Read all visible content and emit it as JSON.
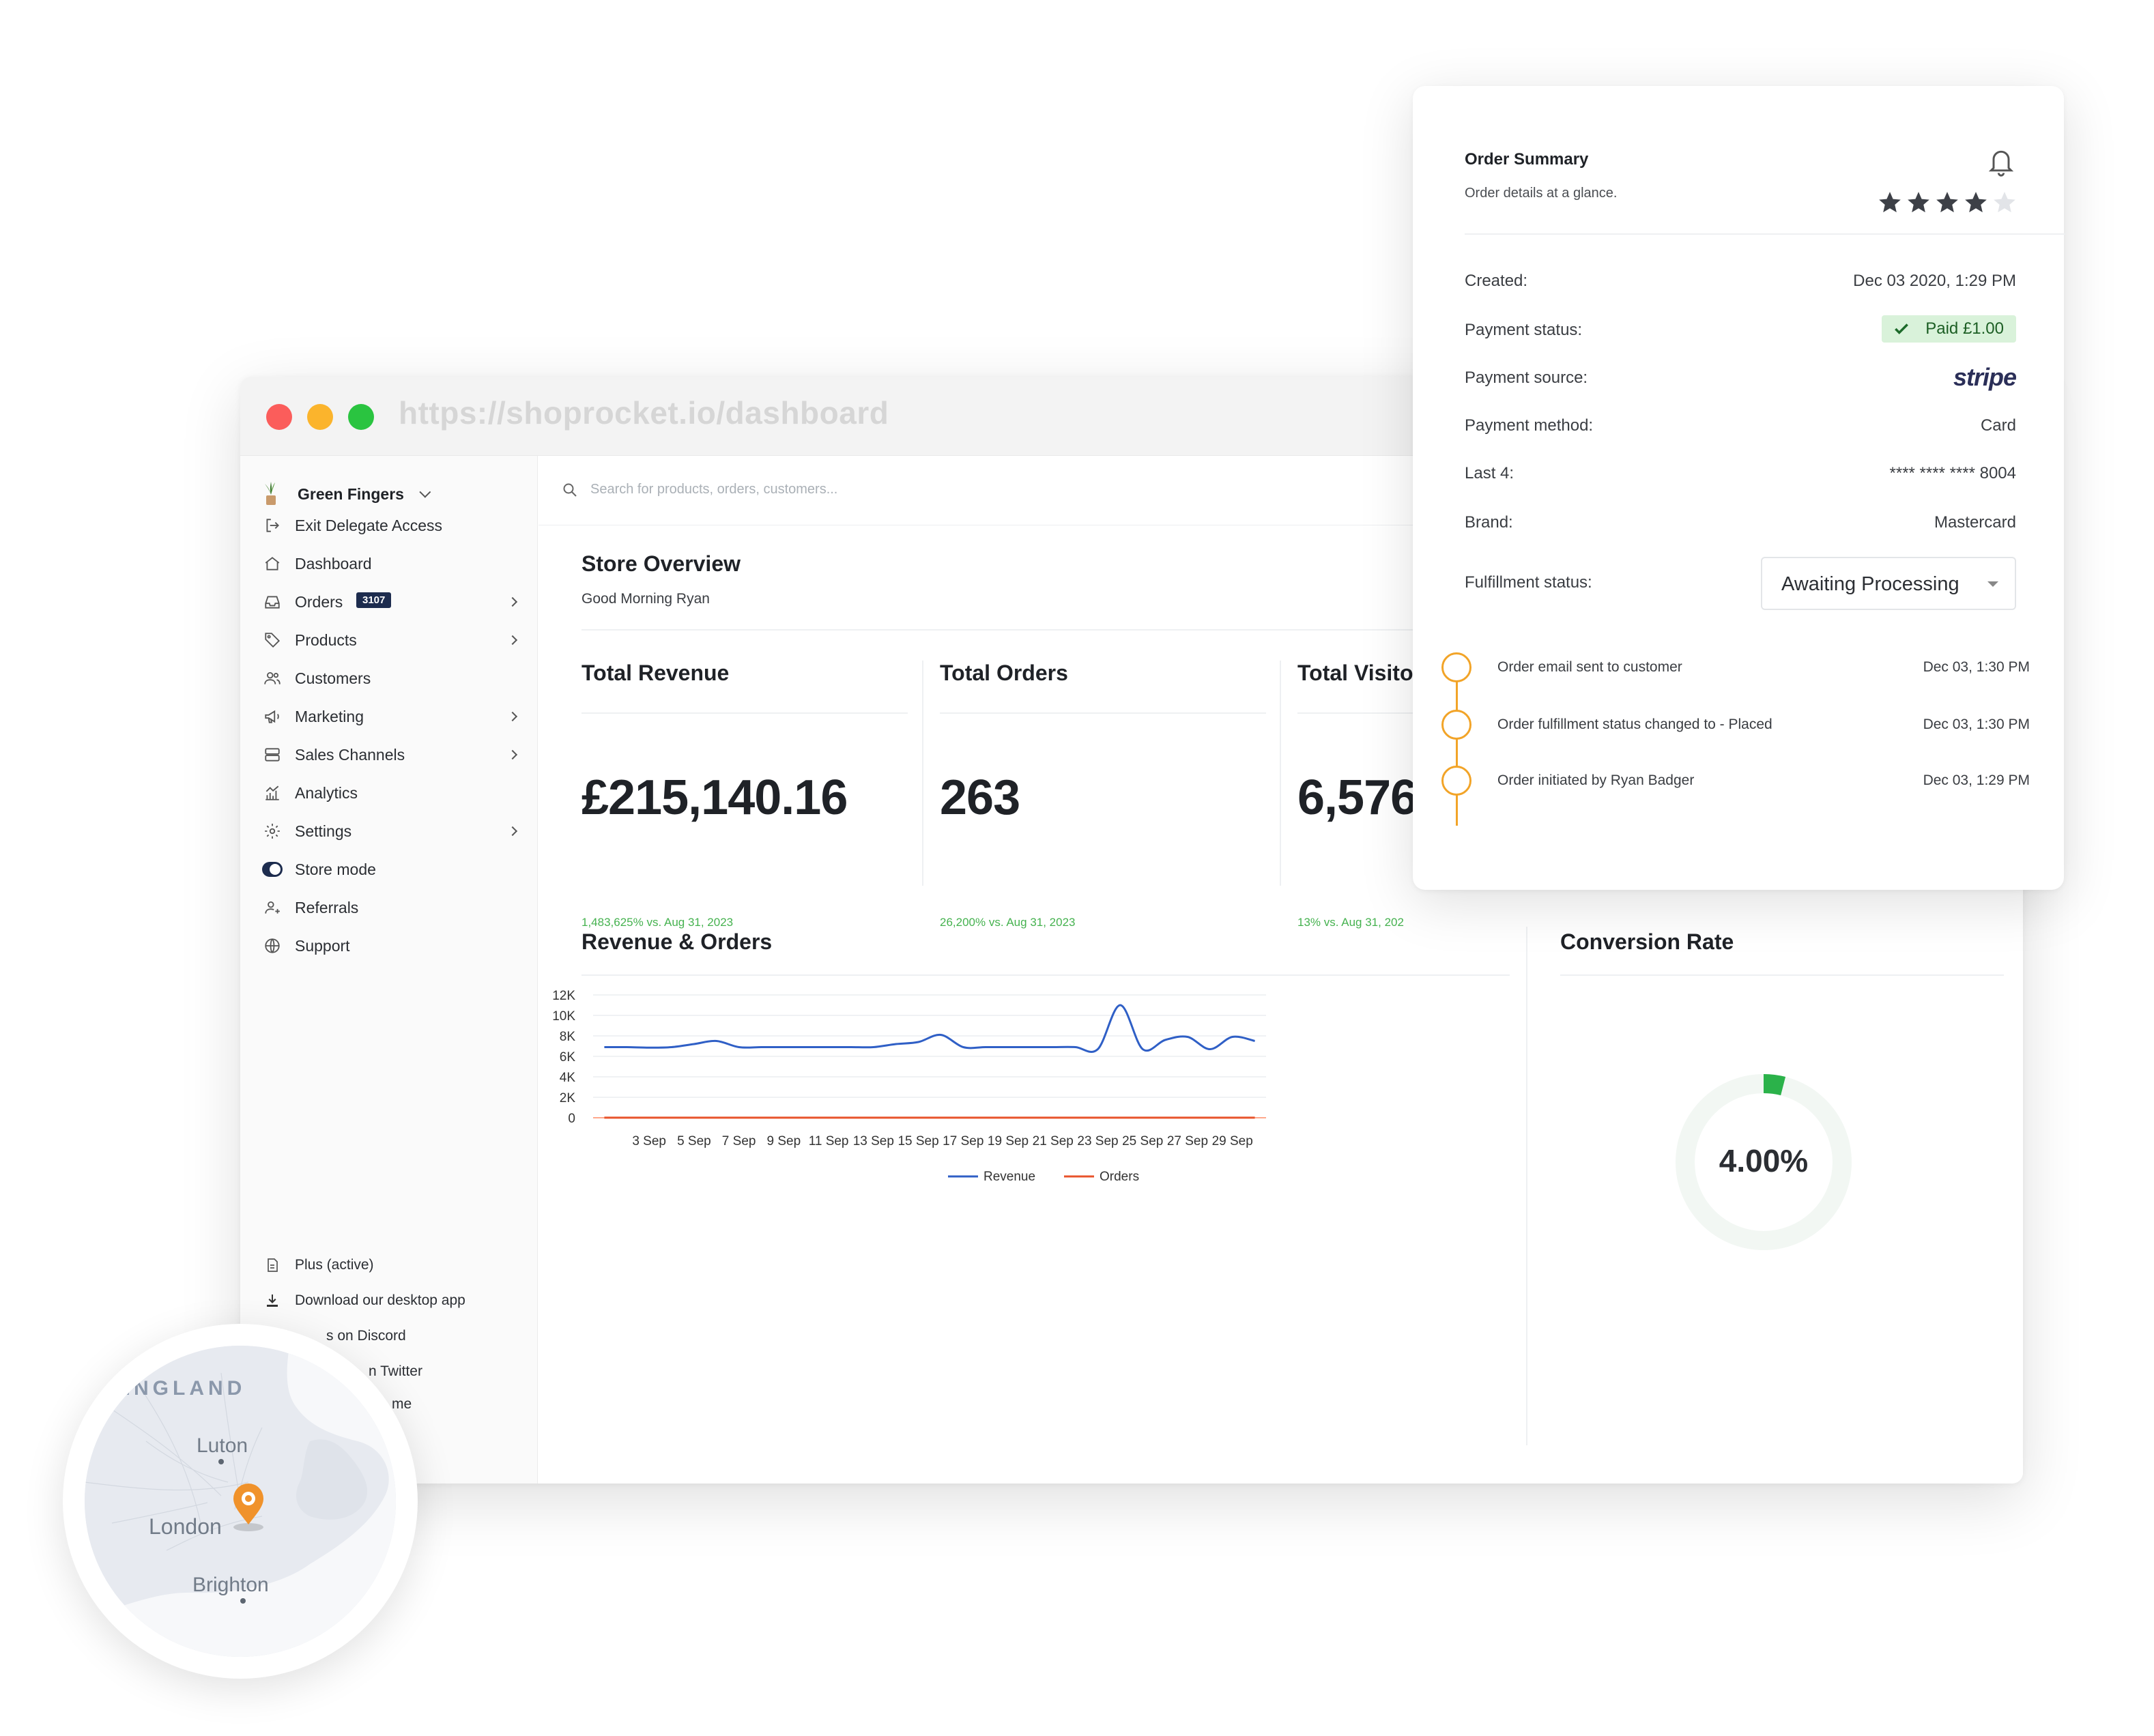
{
  "browser": {
    "url": "https://shoprocket.io/dashboard"
  },
  "sidebar": {
    "store_name": "Green Fingers",
    "items": [
      {
        "label": "Exit Delegate Access",
        "icon": "exit-icon"
      },
      {
        "label": "Dashboard",
        "icon": "home-icon"
      },
      {
        "label": "Orders",
        "icon": "inbox-icon",
        "badge": "3107",
        "has_arrow": true
      },
      {
        "label": "Products",
        "icon": "tag-icon",
        "has_arrow": true
      },
      {
        "label": "Customers",
        "icon": "users-icon"
      },
      {
        "label": "Marketing",
        "icon": "megaphone-icon",
        "has_arrow": true
      },
      {
        "label": "Sales Channels",
        "icon": "server-icon",
        "has_arrow": true
      },
      {
        "label": "Analytics",
        "icon": "analytics-icon"
      },
      {
        "label": "Settings",
        "icon": "gear-icon",
        "has_arrow": true
      },
      {
        "label": "Store mode",
        "icon": "toggle-icon"
      },
      {
        "label": "Referrals",
        "icon": "referral-icon"
      },
      {
        "label": "Support",
        "icon": "globe-icon"
      }
    ],
    "footer": [
      {
        "label": "Plus (active)",
        "icon": "document-icon"
      },
      {
        "label": "Download our desktop app",
        "icon": "download-icon"
      },
      {
        "label": "s on Discord",
        "icon": "discord-icon"
      },
      {
        "label": "n Twitter",
        "icon": "twitter-icon"
      },
      {
        "label": "me",
        "icon": "theme-icon"
      }
    ]
  },
  "search": {
    "placeholder": "Search for products, orders, customers..."
  },
  "overview": {
    "title": "Store Overview",
    "greeting": "Good Morning Ryan"
  },
  "stats": [
    {
      "title": "Total Revenue",
      "value": "£215,140.16",
      "delta": "1,483,625% vs. Aug 31, 2023"
    },
    {
      "title": "Total Orders",
      "value": "263",
      "delta": "26,200% vs. Aug 31, 2023"
    },
    {
      "title": "Total Visito",
      "value": "6,576",
      "delta": "13% vs. Aug 31, 202"
    }
  ],
  "revenue_chart_title": "Revenue & Orders",
  "chart_data": {
    "type": "line",
    "x": [
      "1 Sep",
      "2 Sep",
      "3 Sep",
      "4 Sep",
      "5 Sep",
      "6 Sep",
      "7 Sep",
      "8 Sep",
      "9 Sep",
      "10 Sep",
      "11 Sep",
      "12 Sep",
      "13 Sep",
      "14 Sep",
      "15 Sep",
      "16 Sep",
      "17 Sep",
      "18 Sep",
      "19 Sep",
      "20 Sep",
      "21 Sep",
      "22 Sep",
      "23 Sep",
      "24 Sep",
      "25 Sep",
      "26 Sep",
      "27 Sep",
      "28 Sep",
      "29 Sep",
      "30 Sep"
    ],
    "tick_labels": [
      "3 Sep",
      "5 Sep",
      "7 Sep",
      "9 Sep",
      "11 Sep",
      "13 Sep",
      "15 Sep",
      "17 Sep",
      "19 Sep",
      "21 Sep",
      "23 Sep",
      "25 Sep",
      "27 Sep",
      "29 Sep"
    ],
    "y_ticks": [
      "0",
      "2K",
      "4K",
      "6K",
      "8K",
      "10K",
      "12K"
    ],
    "ylim": [
      0,
      12000
    ],
    "series": [
      {
        "name": "Revenue",
        "color": "#2f5fc6",
        "values": [
          6900,
          6900,
          6850,
          6900,
          7200,
          7500,
          6900,
          6900,
          6900,
          6900,
          6900,
          6900,
          6900,
          7200,
          7400,
          8100,
          6900,
          6900,
          6900,
          6900,
          6900,
          6900,
          6700,
          11000,
          6700,
          7600,
          7900,
          6700,
          7900,
          7500
        ]
      },
      {
        "name": "Orders",
        "color": "#e8532b",
        "values": [
          10,
          8,
          9,
          10,
          8,
          9,
          10,
          8,
          9,
          10,
          8,
          9,
          10,
          8,
          9,
          10,
          8,
          9,
          10,
          8,
          9,
          10,
          8,
          12,
          9,
          10,
          8,
          9,
          10,
          8
        ]
      }
    ],
    "legend": "bottom",
    "grid": true
  },
  "conversion": {
    "title": "Conversion Rate",
    "value": "4.00%",
    "fraction": 0.04,
    "accent": "#2bb24a"
  },
  "order_summary": {
    "title": "Order Summary",
    "subtitle": "Order details at a glance.",
    "rating": 4,
    "rating_max": 5,
    "rows": {
      "created_label": "Created:",
      "created": "Dec 03 2020, 1:29 PM",
      "payment_status_label": "Payment status:",
      "payment_status": "Paid £1.00",
      "payment_source_label": "Payment source:",
      "payment_source": "stripe",
      "payment_method_label": "Payment method:",
      "payment_method": "Card",
      "last4_label": "Last 4:",
      "last4": "**** **** **** 8004",
      "brand_label": "Brand:",
      "brand": "Mastercard",
      "fulfillment_label": "Fulfillment status:",
      "fulfillment": "Awaiting Processing"
    },
    "timeline": [
      {
        "text": "Order email sent to customer",
        "date": "Dec 03, 1:30 PM"
      },
      {
        "text": "Order fulfillment status changed to - Placed",
        "date": "Dec 03, 1:30 PM"
      },
      {
        "text": "Order initiated by Ryan Badger",
        "date": "Dec 03, 1:29 PM"
      }
    ]
  },
  "map": {
    "region": "ENGLAND",
    "cities": [
      "Luton",
      "London",
      "Brighton"
    ],
    "pin_color": "#f0922b"
  }
}
